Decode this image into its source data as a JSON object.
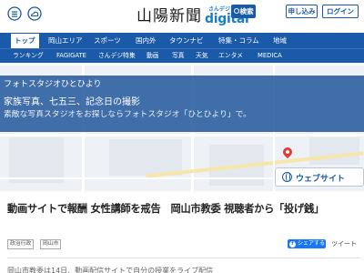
{
  "header": {
    "icons": [
      "menu-list-icon",
      "weather-cloud-icon"
    ],
    "logo_main": "山陽新聞",
    "logo_sub_top": "さんデジ",
    "logo_sub_main": "digital",
    "search_label": "検索",
    "subscribe_label": "申し込み",
    "login_label": "ログイン",
    "accent_color": "#1a5aa8"
  },
  "nav": {
    "items": [
      "トップ",
      "岡山エリア",
      "スポーツ",
      "国内外",
      "タウンナビ",
      "特集・コラム",
      "地域"
    ],
    "active": "トップ"
  },
  "subnav": {
    "items": [
      "ランキング",
      "FAGIGATE",
      "さんデジ特集",
      "動画",
      "写真",
      "天気",
      "エンタメ",
      "MEDICA"
    ]
  },
  "banner": {
    "title": "フォトスタジオひとひより",
    "line1": "家族写真、七五三、記念日の撮影",
    "line2": "素敵な写真スタジオをお探しならフォトスタジオ「ひとひより」で。",
    "button_label": "ウェブサイト"
  },
  "article": {
    "title": "動画サイトで報酬 女性講師を戒告　岡山市教委 視聴者から「投げ銭」",
    "tags": [
      "政治行政",
      "岡山市"
    ],
    "share_label": "シェアする",
    "tweet_label": "ツイート",
    "body_start": "岡山市教委は14日、動画配信サイトで自分の授業をライブ配信"
  }
}
